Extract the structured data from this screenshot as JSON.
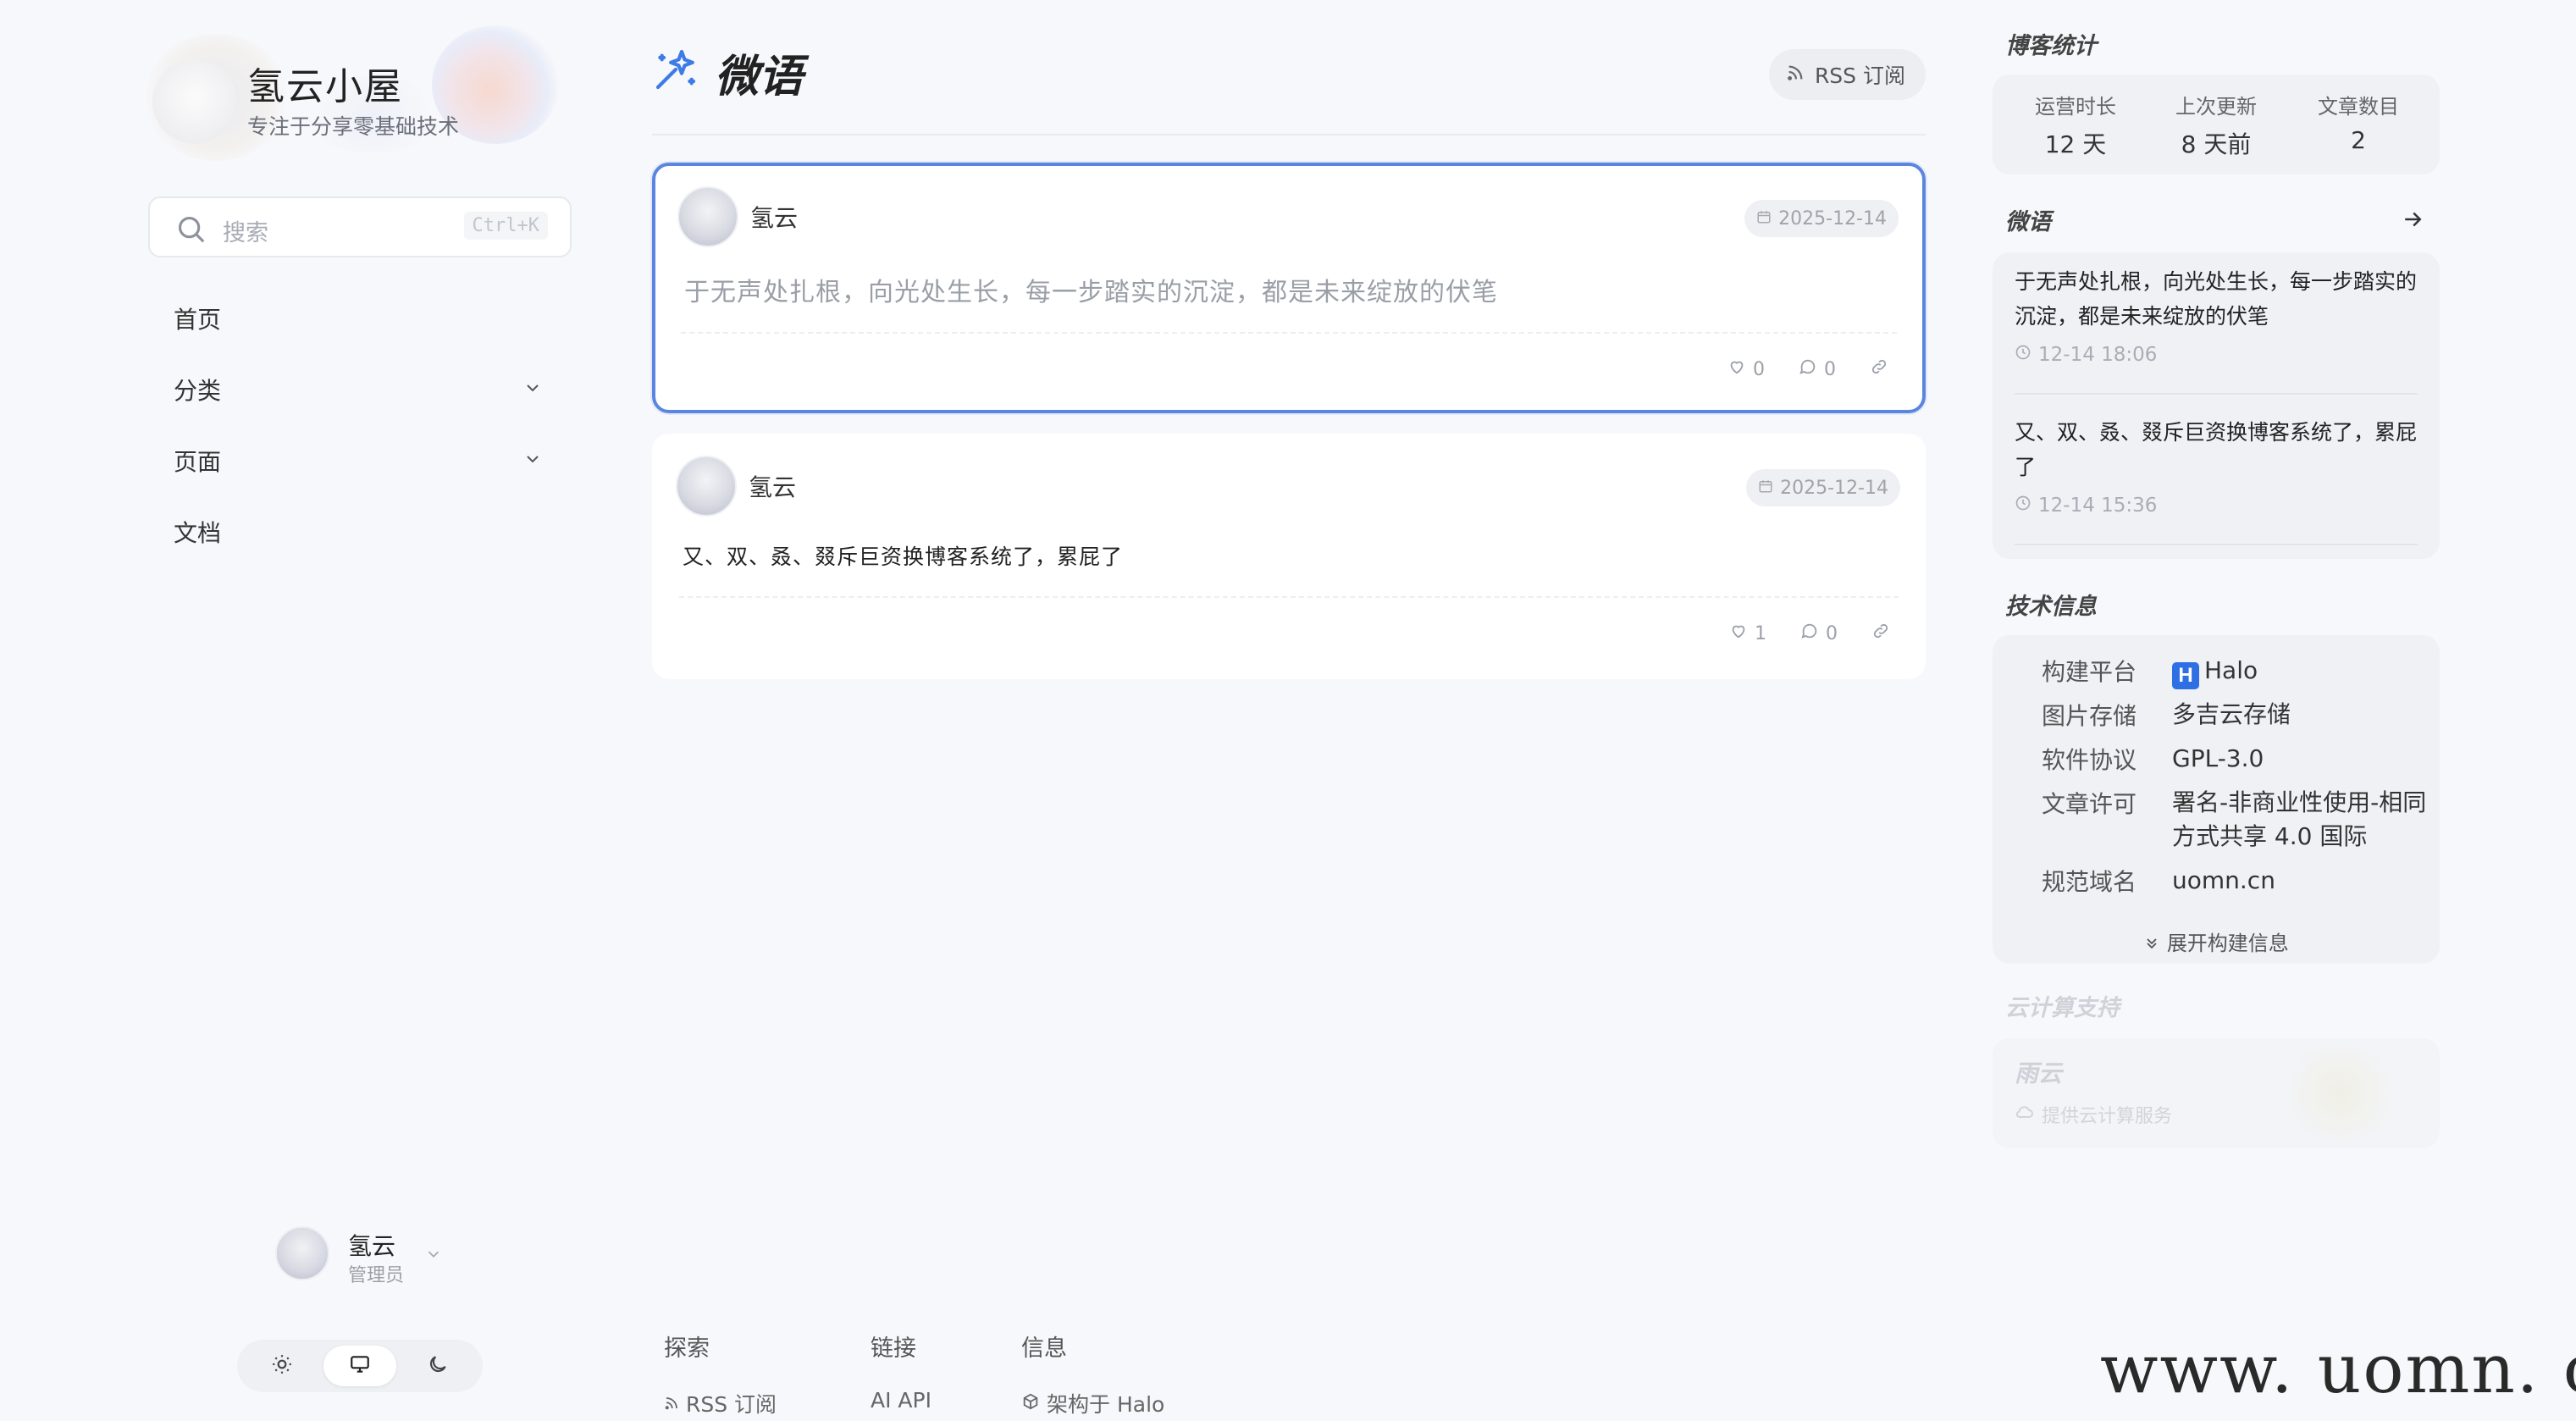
{
  "brand": {
    "title": "氢云小屋",
    "subtitle": "专注于分享零基础技术"
  },
  "search": {
    "placeholder": "搜索",
    "shortcut": "Ctrl+K"
  },
  "nav": [
    {
      "label": "首页",
      "has_children": false
    },
    {
      "label": "分类",
      "has_children": true
    },
    {
      "label": "页面",
      "has_children": true
    },
    {
      "label": "文档",
      "has_children": false
    }
  ],
  "user": {
    "name": "氢云",
    "role": "管理员"
  },
  "theme_switch": {
    "options": [
      "light",
      "system",
      "dark"
    ],
    "active": "system"
  },
  "page": {
    "title": "微语",
    "rss_label": "RSS 订阅"
  },
  "moments": [
    {
      "author": "氢云",
      "date": "2025-12-14",
      "text": "于无声处扎根，向光处生长，每一步踏实的沉淀，都是未来绽放的伏笔",
      "likes": "0",
      "comments": "0",
      "selected": true
    },
    {
      "author": "氢云",
      "date": "2025-12-14",
      "text": "又、双、叒、叕斥巨资换博客系统了，累屁了",
      "likes": "1",
      "comments": "0",
      "selected": false
    }
  ],
  "footer": {
    "explore": {
      "heading": "探索",
      "link": "RSS 订阅"
    },
    "links": {
      "heading": "链接",
      "link": "AI API"
    },
    "info": {
      "heading": "信息",
      "link": "架构于 Halo"
    }
  },
  "stats": {
    "heading": "博客统计",
    "items": [
      {
        "label": "运营时长",
        "value": "12 天"
      },
      {
        "label": "上次更新",
        "value": "8 天前"
      },
      {
        "label": "文章数目",
        "value": "2"
      }
    ]
  },
  "moments_widget": {
    "heading": "微语",
    "items": [
      {
        "text": "于无声处扎根，向光处生长，每一步踏实的沉淀，都是未来绽放的伏笔",
        "time": "12-14 18:06"
      },
      {
        "text": "又、双、叒、叕斥巨资换博客系统了，累屁了",
        "time": "12-14 15:36"
      }
    ]
  },
  "tech_info": {
    "heading": "技术信息",
    "rows": [
      {
        "key": "构建平台",
        "value": "Halo",
        "badge": "H"
      },
      {
        "key": "图片存储",
        "value": "多吉云存储"
      },
      {
        "key": "软件协议",
        "value": "GPL-3.0"
      },
      {
        "key": "文章许可",
        "value": "署名-非商业性使用-相同方式共享 4.0 国际"
      },
      {
        "key": "规范域名",
        "value": "uomn.cn"
      }
    ],
    "expand_label": "展开构建信息"
  },
  "cloud_support": {
    "heading": "云计算支持",
    "name": "雨云",
    "desc": "提供云计算服务"
  },
  "watermark": "www. uomn. cn",
  "colors": {
    "accent": "#5a86e0",
    "background": "#f7f8fb",
    "halo_blue": "#2f6fe4"
  }
}
